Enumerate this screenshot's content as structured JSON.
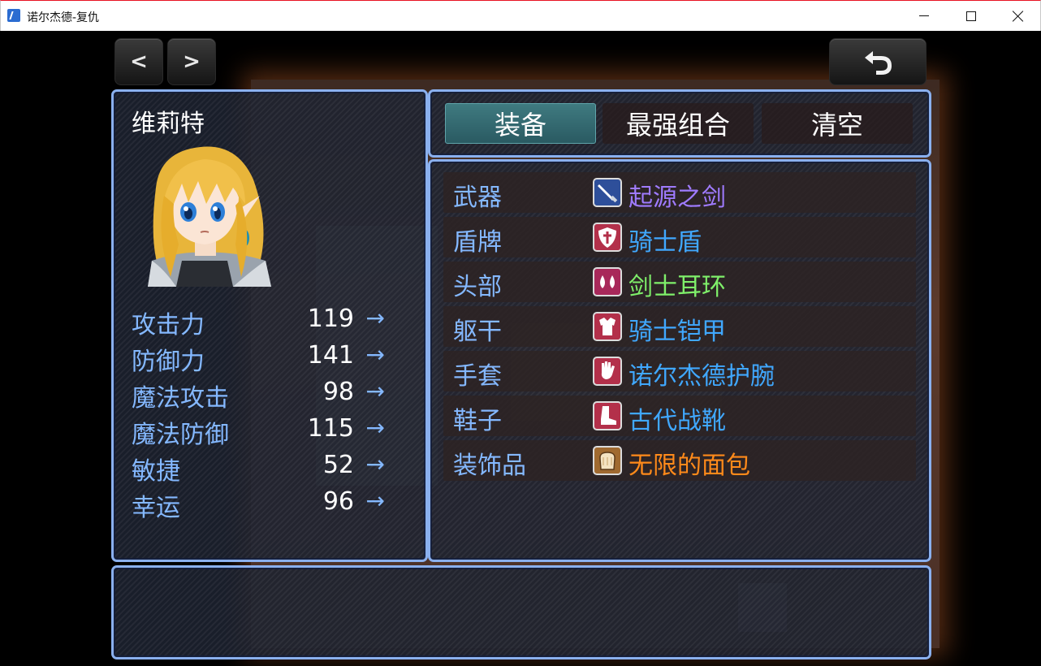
{
  "window": {
    "title": "诺尔杰德-复仇"
  },
  "nav": {
    "prev_label": "<",
    "next_label": ">"
  },
  "actor": {
    "name": "维莉特",
    "stats": [
      {
        "label": "攻击力",
        "value": "119",
        "arrow": "→"
      },
      {
        "label": "防御力",
        "value": "141",
        "arrow": "→"
      },
      {
        "label": "魔法攻击",
        "value": "98",
        "arrow": "→"
      },
      {
        "label": "魔法防御",
        "value": "115",
        "arrow": "→"
      },
      {
        "label": "敏捷",
        "value": "52",
        "arrow": "→"
      },
      {
        "label": "幸运",
        "value": "96",
        "arrow": "→"
      }
    ]
  },
  "commands": [
    {
      "label": "装备",
      "active": true
    },
    {
      "label": "最强组合",
      "active": false
    },
    {
      "label": "清空",
      "active": false
    }
  ],
  "slots": [
    {
      "slot": "武器",
      "item": "起源之剑",
      "color": "#9f7bff",
      "icon": "sword-icon",
      "icon_bg": "#2e4f9a"
    },
    {
      "slot": "盾牌",
      "item": "骑士盾",
      "color": "#40a8ff",
      "icon": "shield-icon",
      "icon_bg": "#b3304a"
    },
    {
      "slot": "头部",
      "item": "剑士耳环",
      "color": "#7fef6a",
      "icon": "earring-icon",
      "icon_bg": "#a8285a"
    },
    {
      "slot": "躯干",
      "item": "骑士铠甲",
      "color": "#40a8ff",
      "icon": "armor-icon",
      "icon_bg": "#b3304a"
    },
    {
      "slot": "手套",
      "item": "诺尔杰德护腕",
      "color": "#40a8ff",
      "icon": "glove-icon",
      "icon_bg": "#b3304a"
    },
    {
      "slot": "鞋子",
      "item": "古代战靴",
      "color": "#40a8ff",
      "icon": "boot-icon",
      "icon_bg": "#b3304a"
    },
    {
      "slot": "装饰品",
      "item": "无限的面包",
      "color": "#ff8a1a",
      "icon": "bread-icon",
      "icon_bg": "#a06a30"
    }
  ],
  "help": {
    "text": ""
  }
}
